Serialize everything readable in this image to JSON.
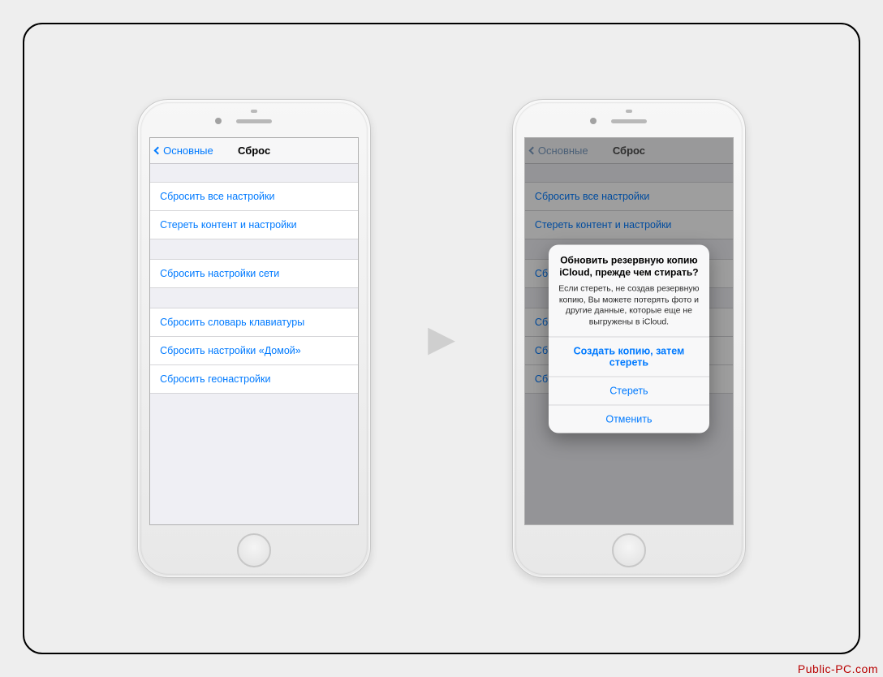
{
  "watermark": "Public-PC.com",
  "nav": {
    "back_label": "Основные",
    "title": "Сброс"
  },
  "reset": {
    "group1": [
      "Сбросить все настройки",
      "Стереть контент и настройки"
    ],
    "group2": [
      "Сбросить настройки сети"
    ],
    "group3": [
      "Сбросить словарь клавиатуры",
      "Сбросить настройки «Домой»",
      "Сбросить геонастройки"
    ]
  },
  "alert": {
    "title": "Обновить резервную копию iCloud, прежде чем стирать?",
    "message": "Если стереть, не создав резервную копию, Вы можете потерять фото и другие данные, которые еще не выгружены в iCloud.",
    "primary": "Создать копию, затем стереть",
    "erase": "Стереть",
    "cancel": "Отменить"
  }
}
